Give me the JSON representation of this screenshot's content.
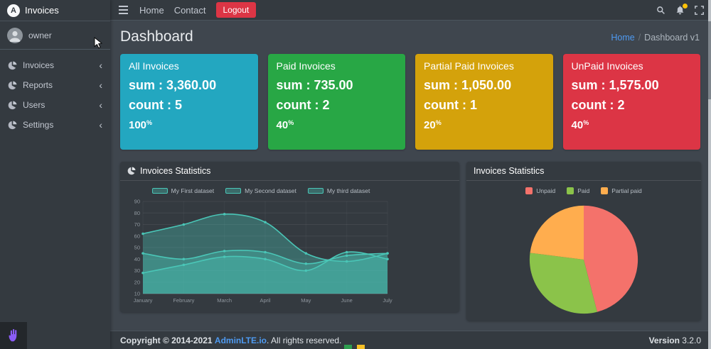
{
  "colors": {
    "sidebar_bg": "#343a40",
    "content_bg": "#3f464e",
    "accent_link": "#4e9af1",
    "logout_red": "#dc3545",
    "badge_yellow": "#ffc107",
    "chart_teal": "#4ac6b7"
  },
  "brand": {
    "logo_letter": "A",
    "title": "Invoices"
  },
  "user": {
    "name": "owner"
  },
  "icons": {
    "chevron_left": "‹"
  },
  "sidebar": {
    "items": [
      {
        "label": "Invoices"
      },
      {
        "label": "Reports"
      },
      {
        "label": "Users"
      },
      {
        "label": "Settings"
      }
    ]
  },
  "navbar": {
    "home": "Home",
    "contact": "Contact",
    "logout": "Logout"
  },
  "page": {
    "title": "Dashboard",
    "breadcrumb_home": "Home",
    "breadcrumb_sep": "/",
    "breadcrumb_current": "Dashboard v1"
  },
  "info_boxes": [
    {
      "title": "All Invoices",
      "sum": "sum : 3,360.00",
      "count": "count : 5",
      "percent": "100",
      "percent_sign": "%",
      "color": "#23a7c0"
    },
    {
      "title": "Paid Invoices",
      "sum": "sum : 735.00",
      "count": "count : 2",
      "percent": "40",
      "percent_sign": "%",
      "color": "#28a745"
    },
    {
      "title": "Partial Paid Invoices",
      "sum": "sum : 1,050.00",
      "count": "count : 1",
      "percent": "20",
      "percent_sign": "%",
      "color": "#d4a20b"
    },
    {
      "title": "UnPaid Invoices",
      "sum": "sum : 1,575.00",
      "count": "count : 2",
      "percent": "40",
      "percent_sign": "%",
      "color": "#dc3545"
    }
  ],
  "cards": {
    "line_title": "Invoices Statistics",
    "pie_title": "Invoices Statistics"
  },
  "chart_data": [
    {
      "type": "line",
      "title": "Invoices Statistics",
      "x": [
        "January",
        "February",
        "March",
        "April",
        "May",
        "June",
        "July"
      ],
      "series": [
        {
          "name": "My First dataset",
          "values": [
            45,
            40,
            47,
            46,
            36,
            43,
            45
          ]
        },
        {
          "name": "My Second dataset",
          "values": [
            62,
            70,
            79,
            72,
            45,
            38,
            45
          ]
        },
        {
          "name": "My third dataset",
          "values": [
            28,
            35,
            42,
            40,
            30,
            46,
            40
          ]
        }
      ],
      "ylim": [
        10,
        90
      ],
      "yticks": [
        90,
        80,
        70,
        60,
        50,
        40,
        30,
        20,
        10
      ],
      "grid": true,
      "legend_position": "top",
      "color": "#4ac6b7",
      "fill_opacity": 0.35
    },
    {
      "type": "pie",
      "title": "Invoices Statistics",
      "labels": [
        "Unpaid",
        "Paid",
        "Partial paid"
      ],
      "values": [
        46,
        31,
        23
      ],
      "colors": [
        "#f4726b",
        "#8bc34a",
        "#ffad4e"
      ],
      "legend_position": "top"
    }
  ],
  "footer": {
    "copyright_strong": "Copyright © 2014-2021",
    "brand_link": "AdminLTE.io",
    "rights": ". All rights reserved.",
    "version_label": "Version",
    "version_value": "3.2.0"
  }
}
